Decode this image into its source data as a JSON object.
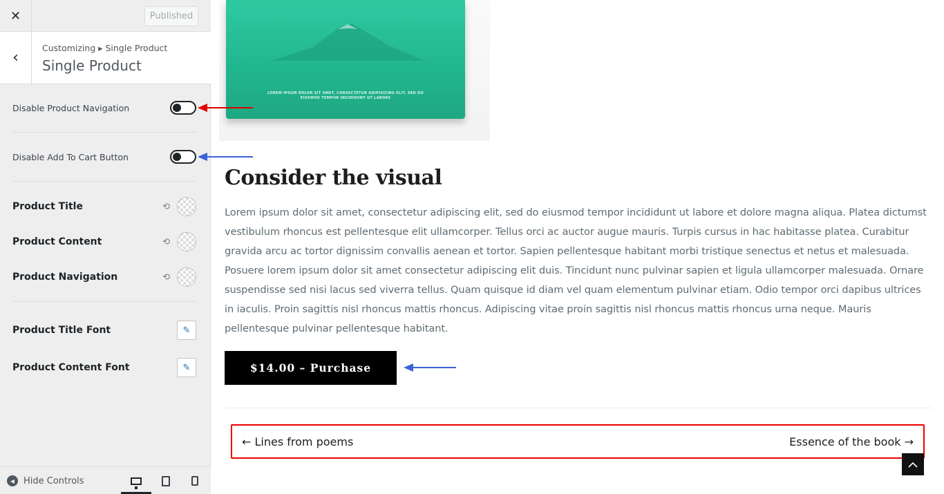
{
  "topbar": {
    "close_icon": "close-icon",
    "published_label": "Published"
  },
  "section": {
    "breadcrumb": "Customizing ▸ Single Product",
    "title": "Single Product",
    "back_icon": "chevron-left-icon"
  },
  "toggles": [
    {
      "label": "Disable Product Navigation",
      "on": false
    },
    {
      "label": "Disable Add To Cart Button",
      "on": false
    }
  ],
  "colors": [
    {
      "label": "Product Title"
    },
    {
      "label": "Product Content"
    },
    {
      "label": "Product Navigation"
    }
  ],
  "fonts": [
    {
      "label": "Product Title Font"
    },
    {
      "label": "Product Content Font"
    }
  ],
  "footer": {
    "hide_controls": "Hide Controls",
    "devices": [
      "desktop",
      "tablet",
      "mobile"
    ],
    "active_device": "desktop"
  },
  "book": {
    "cover_text": "LOREM IPSUM DOLOR SIT AMET, CONSECTETUR ADIPISICING ELIT, SED DO EIUSMOD TEMPOR INCIDIDUNT UT LABORE",
    "cover_color": "#21b58e"
  },
  "content": {
    "heading": "Consider the visual",
    "paragraph": "Lorem ipsum dolor sit amet, consectetur adipiscing elit, sed do eiusmod tempor incididunt ut labore et dolore magna aliqua. Platea dictumst vestibulum rhoncus est pellentesque elit ullamcorper. Tellus orci ac auctor augue mauris. Turpis cursus in hac habitasse platea. Curabitur gravida arcu ac tortor dignissim convallis aenean et tortor. Sapien pellentesque habitant morbi tristique senectus et netus et malesuada. Posuere lorem ipsum dolor sit amet consectetur adipiscing elit duis. Tincidunt nunc pulvinar sapien et ligula ullamcorper malesuada. Ornare suspendisse sed nisi lacus sed viverra tellus. Quam quisque id diam vel quam elementum pulvinar etiam. Odio tempor orci dapibus ultrices in iaculis. Proin sagittis nisl rhoncus mattis rhoncus. Adipiscing vitae proin sagittis nisl rhoncus mattis rhoncus urna neque. Mauris pellentesque pulvinar pellentesque habitant.",
    "buy_button": "$14.00 – Purchase",
    "prev_link": "← Lines from poems",
    "next_link": "Essence of the book →"
  },
  "annotation_colors": {
    "red": "#e00000",
    "blue": "#3a63d8"
  }
}
